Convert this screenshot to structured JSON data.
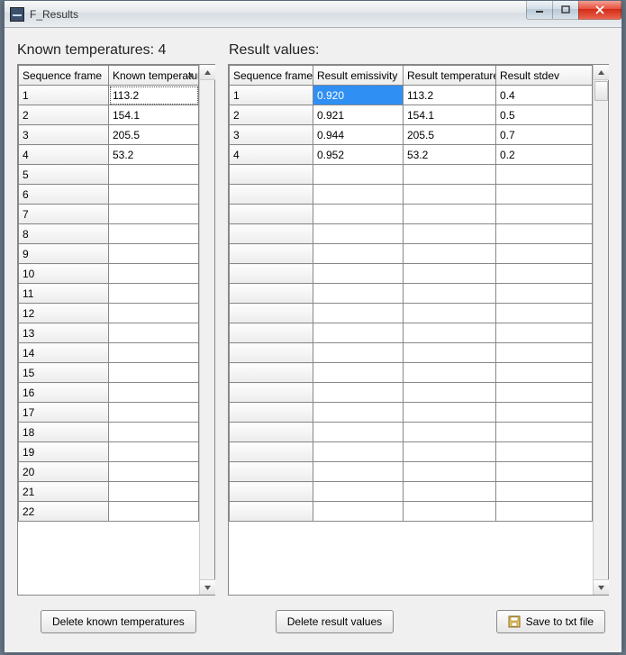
{
  "window": {
    "title": "F_Results"
  },
  "header": {
    "left": "Known temperatures: 4",
    "right": "Result values:"
  },
  "known_table": {
    "columns": [
      "Sequence frame",
      "Known temperature"
    ],
    "rows": [
      {
        "seq": "1",
        "temp": "113.2"
      },
      {
        "seq": "2",
        "temp": "154.1"
      },
      {
        "seq": "3",
        "temp": "205.5"
      },
      {
        "seq": "4",
        "temp": "53.2"
      },
      {
        "seq": "5",
        "temp": ""
      },
      {
        "seq": "6",
        "temp": ""
      },
      {
        "seq": "7",
        "temp": ""
      },
      {
        "seq": "8",
        "temp": ""
      },
      {
        "seq": "9",
        "temp": ""
      },
      {
        "seq": "10",
        "temp": ""
      },
      {
        "seq": "11",
        "temp": ""
      },
      {
        "seq": "12",
        "temp": ""
      },
      {
        "seq": "13",
        "temp": ""
      },
      {
        "seq": "14",
        "temp": ""
      },
      {
        "seq": "15",
        "temp": ""
      },
      {
        "seq": "16",
        "temp": ""
      },
      {
        "seq": "17",
        "temp": ""
      },
      {
        "seq": "18",
        "temp": ""
      },
      {
        "seq": "19",
        "temp": ""
      },
      {
        "seq": "20",
        "temp": ""
      },
      {
        "seq": "21",
        "temp": ""
      },
      {
        "seq": "22",
        "temp": ""
      }
    ]
  },
  "result_table": {
    "columns": [
      "Sequence frame",
      "Result emissivity",
      "Result temperature",
      "Result stdev"
    ],
    "selected_cell": {
      "row": 0,
      "col": 1
    },
    "rows": [
      {
        "seq": "1",
        "emis": "0.920",
        "temp": "113.2",
        "stdev": "0.4"
      },
      {
        "seq": "2",
        "emis": "0.921",
        "temp": "154.1",
        "stdev": "0.5"
      },
      {
        "seq": "3",
        "emis": "0.944",
        "temp": "205.5",
        "stdev": "0.7"
      },
      {
        "seq": "4",
        "emis": "0.952",
        "temp": "53.2",
        "stdev": "0.2"
      },
      {
        "seq": "",
        "emis": "",
        "temp": "",
        "stdev": ""
      },
      {
        "seq": "",
        "emis": "",
        "temp": "",
        "stdev": ""
      },
      {
        "seq": "",
        "emis": "",
        "temp": "",
        "stdev": ""
      },
      {
        "seq": "",
        "emis": "",
        "temp": "",
        "stdev": ""
      },
      {
        "seq": "",
        "emis": "",
        "temp": "",
        "stdev": ""
      },
      {
        "seq": "",
        "emis": "",
        "temp": "",
        "stdev": ""
      },
      {
        "seq": "",
        "emis": "",
        "temp": "",
        "stdev": ""
      },
      {
        "seq": "",
        "emis": "",
        "temp": "",
        "stdev": ""
      },
      {
        "seq": "",
        "emis": "",
        "temp": "",
        "stdev": ""
      },
      {
        "seq": "",
        "emis": "",
        "temp": "",
        "stdev": ""
      },
      {
        "seq": "",
        "emis": "",
        "temp": "",
        "stdev": ""
      },
      {
        "seq": "",
        "emis": "",
        "temp": "",
        "stdev": ""
      },
      {
        "seq": "",
        "emis": "",
        "temp": "",
        "stdev": ""
      },
      {
        "seq": "",
        "emis": "",
        "temp": "",
        "stdev": ""
      },
      {
        "seq": "",
        "emis": "",
        "temp": "",
        "stdev": ""
      },
      {
        "seq": "",
        "emis": "",
        "temp": "",
        "stdev": ""
      },
      {
        "seq": "",
        "emis": "",
        "temp": "",
        "stdev": ""
      },
      {
        "seq": "",
        "emis": "",
        "temp": "",
        "stdev": ""
      }
    ]
  },
  "buttons": {
    "delete_known": "Delete known temperatures",
    "delete_results": "Delete result values",
    "save": "Save to txt file"
  }
}
